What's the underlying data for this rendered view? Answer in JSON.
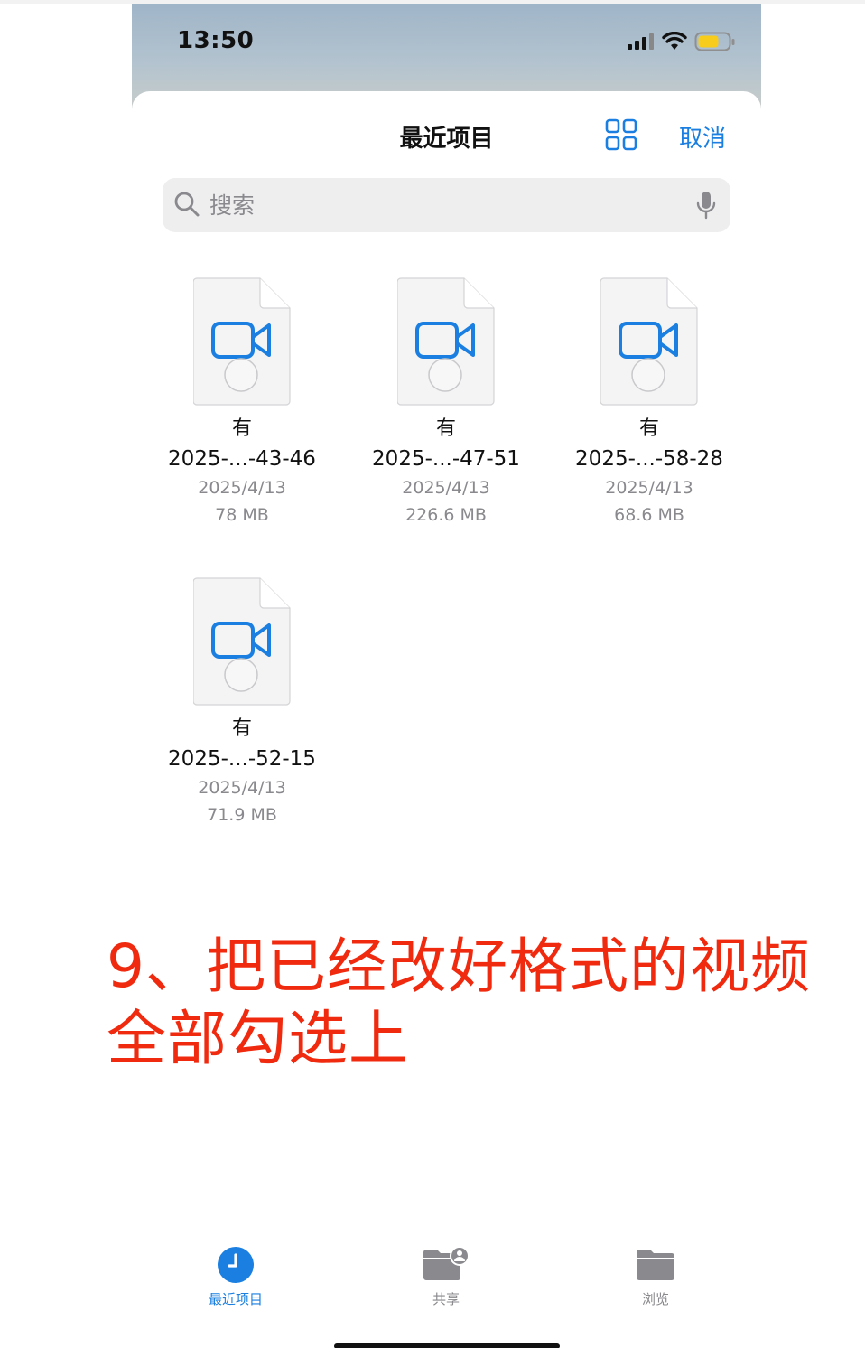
{
  "status_bar": {
    "time": "13:50"
  },
  "nav": {
    "title": "最近项目",
    "cancel_label": "取消",
    "grid_icon": "grid-view-icon"
  },
  "search": {
    "placeholder": "搜索",
    "value": ""
  },
  "files": [
    {
      "owner": "有",
      "name": "2025-...-43-46",
      "date": "2025/4/13",
      "size": "78 MB",
      "icon": "video-camera-icon"
    },
    {
      "owner": "有",
      "name": "2025-...-47-51",
      "date": "2025/4/13",
      "size": "226.6 MB",
      "icon": "video-camera-icon"
    },
    {
      "owner": "有",
      "name": "2025-...-58-28",
      "date": "2025/4/13",
      "size": "68.6 MB",
      "icon": "video-camera-icon"
    },
    {
      "owner": "有",
      "name": "2025-...-52-15",
      "date": "2025/4/13",
      "size": "71.9 MB",
      "icon": "video-camera-icon"
    }
  ],
  "annotation": {
    "line1": "9、把已经改好格式的视频",
    "line2": "全部勾选上"
  },
  "tabbar": {
    "items": [
      {
        "label": "最近项目",
        "icon": "clock-icon",
        "active": true
      },
      {
        "label": "共享",
        "icon": "shared-folder-icon",
        "active": false
      },
      {
        "label": "浏览",
        "icon": "folder-icon",
        "active": false
      }
    ]
  },
  "colors": {
    "accent": "#1a7fe0",
    "annotation": "#f02a0f",
    "inactive": "#8a8a8e"
  }
}
